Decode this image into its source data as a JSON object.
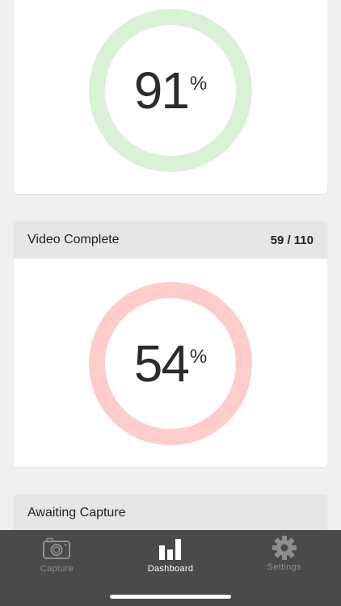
{
  "cards": [
    {
      "title": "",
      "count": "",
      "percent_value": "91",
      "percent_symbol": "%",
      "progress": 0.91,
      "ring_color": "#d9f2d6"
    },
    {
      "title": "Video Complete",
      "count": "59 / 110",
      "percent_value": "54",
      "percent_symbol": "%",
      "progress": 0.54,
      "ring_color": "#ffcccc"
    },
    {
      "title": "Awaiting Capture"
    }
  ],
  "tabbar": {
    "tabs": [
      {
        "label": "Capture",
        "icon": "camera-icon",
        "active": false
      },
      {
        "label": "Dashboard",
        "icon": "bar-chart-icon",
        "active": true
      },
      {
        "label": "Settings",
        "icon": "gear-icon",
        "active": false
      }
    ]
  },
  "colors": {
    "background": "#f0f0f0",
    "card_header": "#e6e6e6",
    "tabbar": "#4a4a4a",
    "tab_active": "#ffffff",
    "tab_inactive": "#8e8e8e"
  }
}
